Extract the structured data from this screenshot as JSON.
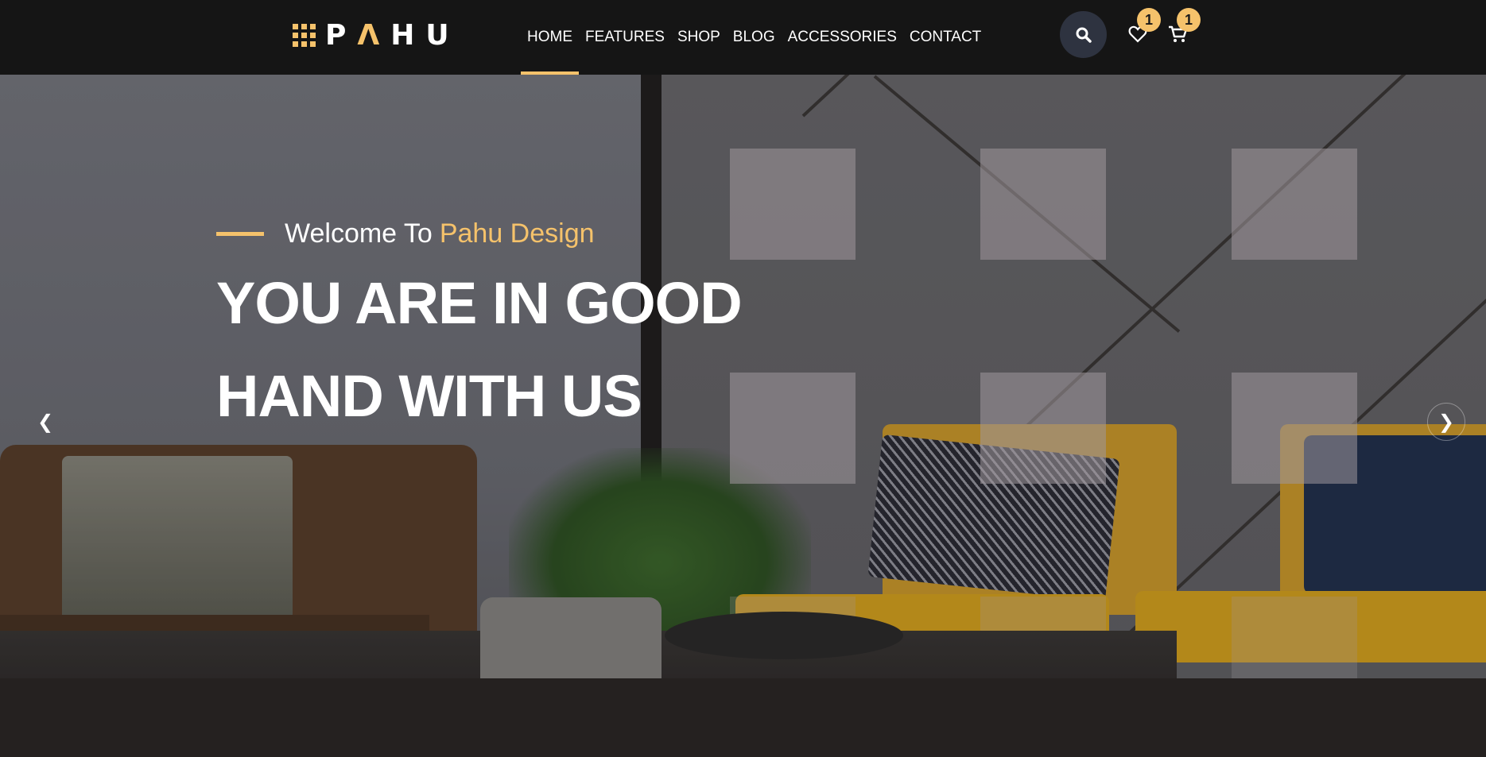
{
  "brand": {
    "logo_text_1": "P",
    "logo_text_2": "Λ",
    "logo_text_3": "HU"
  },
  "nav": {
    "items": [
      {
        "label": "HOME",
        "active": true
      },
      {
        "label": "FEATURES",
        "active": false
      },
      {
        "label": "SHOP",
        "active": false
      },
      {
        "label": "BLOG",
        "active": false
      },
      {
        "label": "ACCESSORIES",
        "active": false
      },
      {
        "label": "CONTACT",
        "active": false
      }
    ]
  },
  "header_actions": {
    "search_icon": "search-icon",
    "wishlist_icon": "heart-icon",
    "wishlist_count": "1",
    "cart_icon": "cart-icon",
    "cart_count": "1"
  },
  "hero": {
    "welcome_prefix": "Welcome To",
    "welcome_accent": "Pahu Design",
    "headline_line_1": "YOU ARE IN GOOD",
    "headline_line_2": "HAND WITH US",
    "prev_arrow": "❮",
    "next_arrow": "❯"
  },
  "colors": {
    "accent": "#f5c26b",
    "header_bg": "#151515",
    "search_bg": "#2e3340"
  }
}
